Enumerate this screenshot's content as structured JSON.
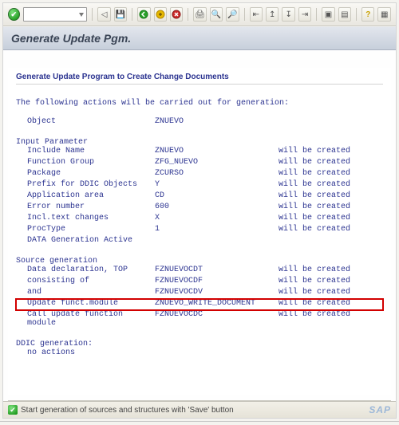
{
  "toolbar": {
    "dropdown_value": ""
  },
  "title": "Generate Update Pgm.",
  "subtitle": "Generate Update Program to Create Change Documents",
  "intro_line": "The following actions will be carried out for generation:",
  "object_row": {
    "label": "Object",
    "value": "ZNUEVO"
  },
  "sections": {
    "input": {
      "heading": "Input Parameter",
      "rows": [
        {
          "label": "Include Name",
          "value": "ZNUEVO",
          "status": "will be created"
        },
        {
          "label": "Function Group",
          "value": "ZFG_NUEVO",
          "status": "will be created"
        },
        {
          "label": "Package",
          "value": "ZCURSO",
          "status": "will be created"
        },
        {
          "label": "Prefix for DDIC Objects",
          "value": "Y",
          "status": "will be created"
        },
        {
          "label": "Application area",
          "value": "CD",
          "status": "will be created"
        },
        {
          "label": "Error number",
          "value": "600",
          "status": "will be created"
        },
        {
          "label": "Incl.text changes",
          "value": "X",
          "status": "will be created"
        },
        {
          "label": "ProcType",
          "value": "1",
          "status": "will be created"
        },
        {
          "label": "DATA Generation Active",
          "value": "",
          "status": ""
        }
      ]
    },
    "sourcegen": {
      "heading": "Source generation",
      "rows": [
        {
          "label": "Data declaration, TOP",
          "value": "FZNUEVOCDT",
          "status": "will be created"
        },
        {
          "label": "consisting of",
          "value": "FZNUEVOCDF",
          "status": "will be created"
        },
        {
          "label": "and",
          "value": "FZNUEVOCDV",
          "status": "will be created"
        },
        {
          "label": "Update funct.module",
          "value": "ZNUEVO_WRITE_DOCUMENT",
          "status": "will be created",
          "highlight": true
        },
        {
          "label": "Call update function module",
          "value": "FZNUEVOCDC",
          "status": "will be created"
        }
      ]
    },
    "ddic": {
      "heading": "DDIC generation:",
      "line": "no actions"
    }
  },
  "footer": {
    "message": "Start generation of sources and structures with 'Save' button",
    "brand": "SAP"
  }
}
